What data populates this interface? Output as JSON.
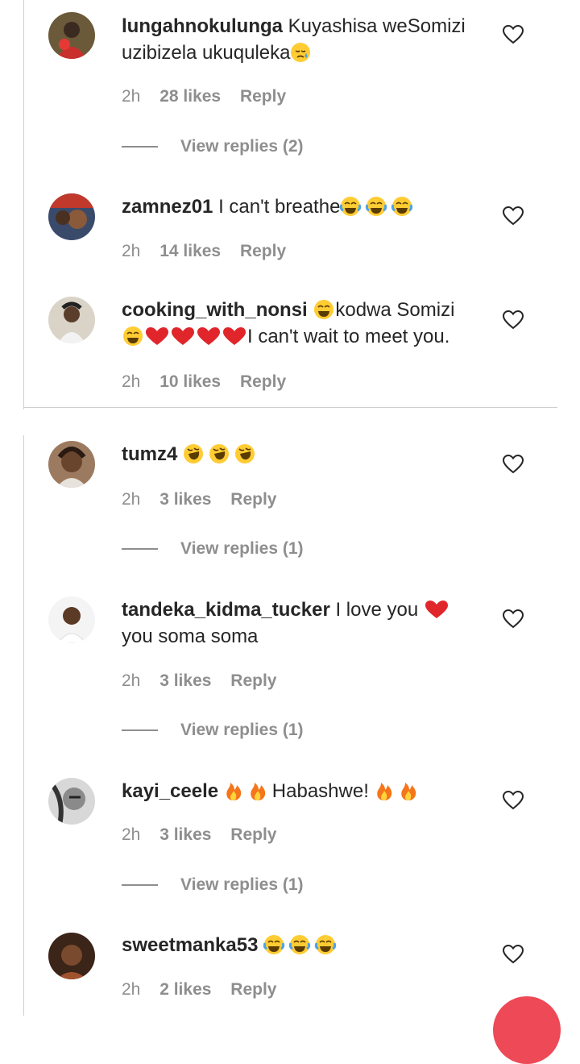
{
  "comments": [
    {
      "user": "lungahnokulunga",
      "text": "Kuyashisa weSomizi uzibizela ukuquleka",
      "emoji_after": "sleepy-face",
      "time": "2h",
      "likes": "28 likes",
      "reply": "Reply",
      "view_replies": "View replies (2)"
    },
    {
      "user": "zamnez01",
      "text": "I can't breathe",
      "emoji_after": "joy-x3",
      "time": "2h",
      "likes": "14 likes",
      "reply": "Reply"
    },
    {
      "user": "cooking_with_nonsi",
      "text_a": "kodwa Somizi",
      "text_b": "I can't wait to meet you.",
      "time": "2h",
      "likes": "10 likes",
      "reply": "Reply"
    },
    {
      "user": "tumz4",
      "emoji_after": "rofl-x3",
      "time": "2h",
      "likes": "3 likes",
      "reply": "Reply",
      "view_replies": "View replies (1)"
    },
    {
      "user": "tandeka_kidma_tucker",
      "text_a": "I love you",
      "text_b": "you soma soma",
      "time": "2h",
      "likes": "3 likes",
      "reply": "Reply",
      "view_replies": "View replies (1)"
    },
    {
      "user": "kayi_ceele",
      "text": "Habashwe!",
      "time": "2h",
      "likes": "3 likes",
      "reply": "Reply",
      "view_replies": "View replies (1)"
    },
    {
      "user": "sweetmanka53",
      "emoji_after": "joy-x3",
      "time": "2h",
      "likes": "2 likes",
      "reply": "Reply"
    }
  ],
  "colors": {
    "text": "#262626",
    "muted": "#8e8e8e",
    "divider": "#cfcfcf",
    "accent": "#ed4956"
  },
  "icons": {
    "like": "heart-outline-icon"
  }
}
